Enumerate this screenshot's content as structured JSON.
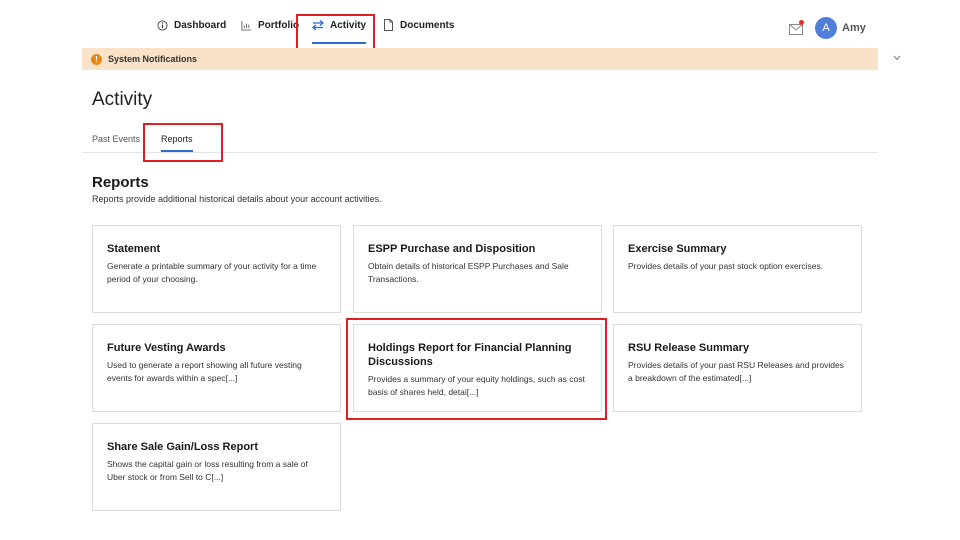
{
  "nav": {
    "items": [
      {
        "label": "Dashboard",
        "icon": "info-circle-icon"
      },
      {
        "label": "Portfolio",
        "icon": "chart-icon"
      },
      {
        "label": "Activity",
        "icon": "swap-arrows-icon"
      },
      {
        "label": "Documents",
        "icon": "document-icon"
      }
    ],
    "active": "Activity"
  },
  "user": {
    "initial": "A",
    "name": "Amy"
  },
  "notifications": {
    "label": "System Notifications",
    "icon": "warning-icon"
  },
  "page": {
    "title": "Activity"
  },
  "tabs": [
    {
      "label": "Past Events"
    },
    {
      "label": "Reports"
    }
  ],
  "reports": {
    "title": "Reports",
    "description": "Reports provide additional historical details about your account activities.",
    "cards": [
      {
        "title": "Statement",
        "description": "Generate a printable summary of your activity for a time period of your choosing."
      },
      {
        "title": "ESPP Purchase and Disposition",
        "description": "Obtain details of historical ESPP Purchases and Sale Transactions."
      },
      {
        "title": "Exercise Summary",
        "description": "Provides details of your past stock option exercises."
      },
      {
        "title": "Future Vesting Awards",
        "description": "Used to generate a report showing all future vesting events for awards within a spec[...]"
      },
      {
        "title": "Holdings Report for Financial Planning Discussions",
        "description": "Provides a summary of your equity holdings, such as cost basis of shares held, detai[...]"
      },
      {
        "title": "RSU Release Summary",
        "description": "Provides details of your past RSU Releases and provides a breakdown of the estimated[...]"
      },
      {
        "title": "Share Sale Gain/Loss Report",
        "description": "Shows the capital gain or loss resulting from a sale of Uber stock or from Sell to C[...]"
      }
    ]
  },
  "colors": {
    "accent": "#2b6cd6",
    "highlight": "#e02020",
    "notification_bg": "#f9e2c8",
    "avatar": "#4f7fd8"
  }
}
